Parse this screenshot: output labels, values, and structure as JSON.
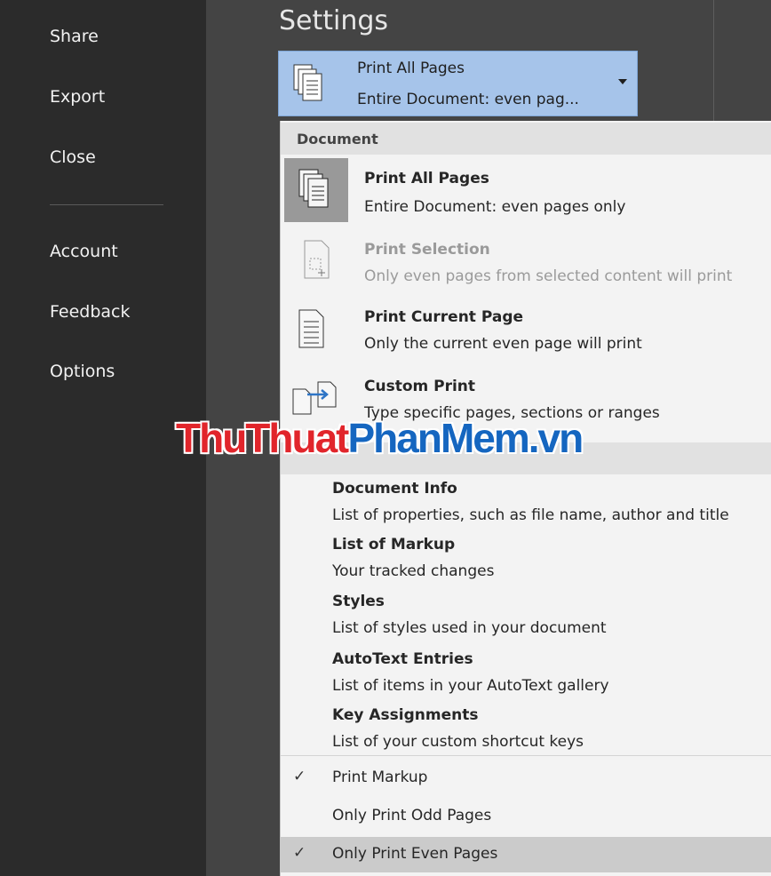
{
  "nav": {
    "items": [
      {
        "label": "Share"
      },
      {
        "label": "Export"
      },
      {
        "label": "Close"
      },
      {
        "label": "Account"
      },
      {
        "label": "Feedback"
      },
      {
        "label": "Options"
      }
    ]
  },
  "settings": {
    "title": "Settings",
    "dropdown": {
      "line1": "Print All Pages",
      "line2": "Entire Document: even pag..."
    }
  },
  "menu": {
    "document_header": "Document",
    "items": [
      {
        "title": "Print All Pages",
        "desc": "Entire Document: even pages only"
      },
      {
        "title": "Print Selection",
        "desc": "Only even pages from selected content will print"
      },
      {
        "title": "Print Current Page",
        "desc": "Only the current even page will print"
      },
      {
        "title": "Custom Print",
        "desc": "Type specific pages, sections or ranges"
      }
    ],
    "info_items": [
      {
        "title": "Document Info",
        "desc": "List of properties, such as file name, author and title"
      },
      {
        "title": "List of Markup",
        "desc": "Your tracked changes"
      },
      {
        "title": "Styles",
        "desc": "List of styles used in your document"
      },
      {
        "title": "AutoText Entries",
        "desc": "List of items in your AutoText gallery"
      },
      {
        "title": "Key Assignments",
        "desc": "List of your custom shortcut keys"
      }
    ],
    "options": [
      {
        "label": "Print Markup",
        "check": "✓"
      },
      {
        "label": "Only Print Odd Pages",
        "check": ""
      },
      {
        "label": "Only Print Even Pages",
        "check": "✓"
      }
    ]
  },
  "watermark": {
    "part1": "ThuThuat",
    "part2": "PhanMem.vn"
  }
}
